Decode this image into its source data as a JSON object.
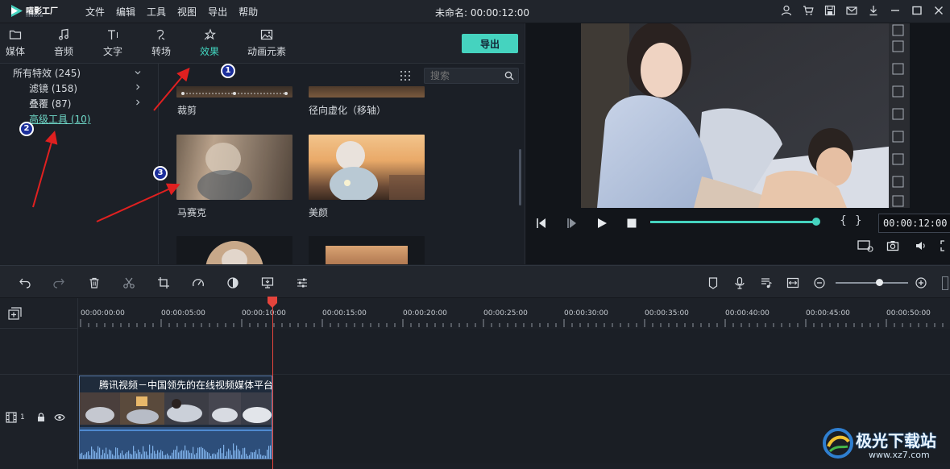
{
  "app": {
    "logo_name": "喵影工厂",
    "logo_sub": "filmora",
    "menu": [
      "文件",
      "编辑",
      "工具",
      "视图",
      "导出",
      "帮助"
    ],
    "doc_title": "未命名: 00:00:12:00"
  },
  "tabs": [
    {
      "label": "媒体",
      "icon": "folder-icon"
    },
    {
      "label": "音频",
      "icon": "music-note-icon"
    },
    {
      "label": "文字",
      "icon": "text-icon"
    },
    {
      "label": "转场",
      "icon": "transition-icon"
    },
    {
      "label": "效果",
      "icon": "effects-icon",
      "active": true
    },
    {
      "label": "动画元素",
      "icon": "image-icon"
    }
  ],
  "export_label": "导出",
  "tree": {
    "all": "所有特效 (245)",
    "filters": "滤镜 (158)",
    "overlays": "叠覆 (87)",
    "advanced": "高级工具 (10)"
  },
  "search": {
    "placeholder": "搜索"
  },
  "effects": [
    {
      "label": "裁剪"
    },
    {
      "label": "径向虚化（移轴）"
    },
    {
      "label": "马赛克"
    },
    {
      "label": "美颜"
    }
  ],
  "preview": {
    "timecode": "00:00:12:00",
    "progress": 1.0
  },
  "timeline": {
    "ruler_labels": [
      "00:00:00:00",
      "00:00:05:00",
      "00:00:10:00",
      "00:00:15:00",
      "00:00:20:00",
      "00:00:25:00",
      "00:00:30:00",
      "00:00:35:00",
      "00:00:40:00",
      "00:00:45:00",
      "00:00:50:00"
    ],
    "track_number": "1",
    "clip_title": "腾讯视频－中国领先的在线视频媒体平台",
    "zoom_level": 0.6
  },
  "annotations": {
    "badge1": "1",
    "badge2": "2",
    "badge3": "3"
  },
  "watermark": {
    "main": "极光下载站",
    "url": "www.xz7.com"
  },
  "colors": {
    "accent": "#45d3bf",
    "playhead": "#e5443c",
    "arrow": "#e02020",
    "badge": "#1c2f9b"
  }
}
